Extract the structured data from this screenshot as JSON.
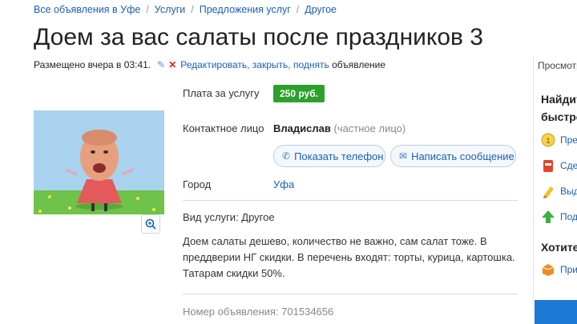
{
  "breadcrumbs": [
    "Все объявления в Уфе",
    "Услуги",
    "Предложения услуг",
    "Другое"
  ],
  "title": "Доем за вас салаты после праздников 3",
  "meta": {
    "posted": "Размещено вчера в 03:41.",
    "edit_link": "Редактировать, закрыть, поднять",
    "suffix": "объявление"
  },
  "details": {
    "price_label": "Плата за услугу",
    "price_value": "250 руб.",
    "contact_label": "Контактное лицо",
    "contact_name": "Владислав",
    "contact_type": "(частное лицо)",
    "show_phone": "Показать телефон",
    "write_message": "Написать сообщение",
    "city_label": "Город",
    "city_value": "Уфа"
  },
  "service_type": "Вид услуги: Другое",
  "description": "Доем салаты дешево, количество не важно, сам салат тоже. В преддверии НГ скидки. В перечень входят: торты, курица, картошка. Татарам скидки 50%.",
  "ad_number": "Номер объявления: 701534656",
  "sidebar": {
    "views": "Просмотр",
    "heading1_line1": "Найдит",
    "heading1_line2": "быстре",
    "items": [
      "Пре",
      "Сде",
      "Выд",
      "Под"
    ],
    "heading2": "Хотите",
    "item5": "При"
  },
  "colors": {
    "link": "#1a5fb4",
    "price_bg": "#2ca02c",
    "accent_blue": "#1d7ad4",
    "delete_red": "#d0271c"
  },
  "icons": {
    "edit": "pencil-icon",
    "delete": "close-icon",
    "phone": "phone-icon",
    "message": "envelope-icon",
    "zoom": "zoom-in-icon"
  }
}
